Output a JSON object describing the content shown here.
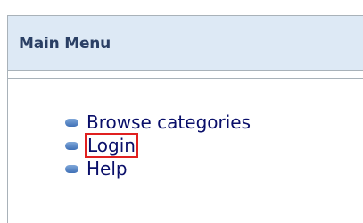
{
  "menu": {
    "title": "Main Menu",
    "items": [
      {
        "label": "Browse categories",
        "icon": "bullet-icon"
      },
      {
        "label": "Login",
        "icon": "bullet-icon",
        "highlighted": true
      },
      {
        "label": "Help",
        "icon": "bullet-icon"
      }
    ]
  },
  "colors": {
    "header_background": "#dde9f5",
    "title_text": "#2a3f64",
    "link_text": "#0a0f6a",
    "highlight_border": "#e02020",
    "bullet": "#4f7fc0"
  }
}
